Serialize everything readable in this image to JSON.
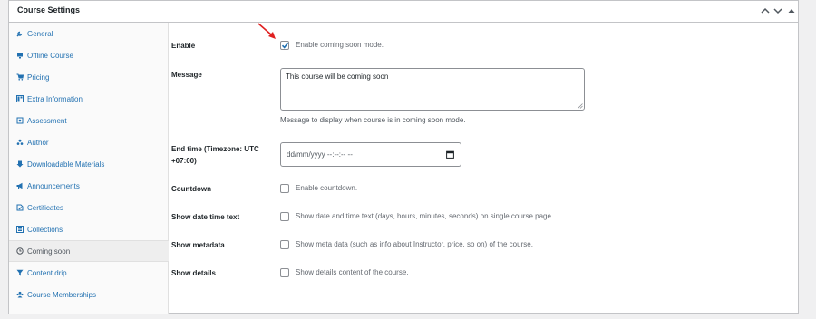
{
  "panel": {
    "title": "Course Settings"
  },
  "sidebar": {
    "items": [
      {
        "label": "General",
        "icon": "wrench-icon"
      },
      {
        "label": "Offline Course",
        "icon": "monitor-icon"
      },
      {
        "label": "Pricing",
        "icon": "cart-icon"
      },
      {
        "label": "Extra Information",
        "icon": "layout-icon"
      },
      {
        "label": "Assessment",
        "icon": "awards-icon"
      },
      {
        "label": "Author",
        "icon": "users-icon"
      },
      {
        "label": "Downloadable Materials",
        "icon": "download-icon"
      },
      {
        "label": "Announcements",
        "icon": "megaphone-icon"
      },
      {
        "label": "Certificates",
        "icon": "certificate-icon"
      },
      {
        "label": "Collections",
        "icon": "list-icon"
      },
      {
        "label": "Coming soon",
        "icon": "clock-icon",
        "active": true
      },
      {
        "label": "Content drip",
        "icon": "filter-icon"
      },
      {
        "label": "Course Memberships",
        "icon": "groups-icon"
      }
    ]
  },
  "fields": {
    "enable": {
      "label": "Enable",
      "option": "Enable coming soon mode.",
      "checked": true
    },
    "message": {
      "label": "Message",
      "value": "This course will be coming soon",
      "description": "Message to display when course is in coming soon mode."
    },
    "end_time": {
      "label_line1": "End time (Timezone: UTC",
      "label_line2": "+07:00)",
      "placeholder": "dd/mm/yyyy --:--:-- --"
    },
    "countdown": {
      "label": "Countdown",
      "option": "Enable countdown.",
      "checked": false
    },
    "show_date_time_text": {
      "label": "Show date time text",
      "option": "Show date and time text (days, hours, minutes, seconds) on single course page.",
      "checked": false
    },
    "show_metadata": {
      "label": "Show metadata",
      "option": "Show meta data (such as info about Instructor, price, so on) of the course.",
      "checked": false
    },
    "show_details": {
      "label": "Show details",
      "option": "Show details content of the course.",
      "checked": false
    }
  },
  "colors": {
    "link": "#2271b1",
    "annotation_arrow": "#e02020"
  }
}
